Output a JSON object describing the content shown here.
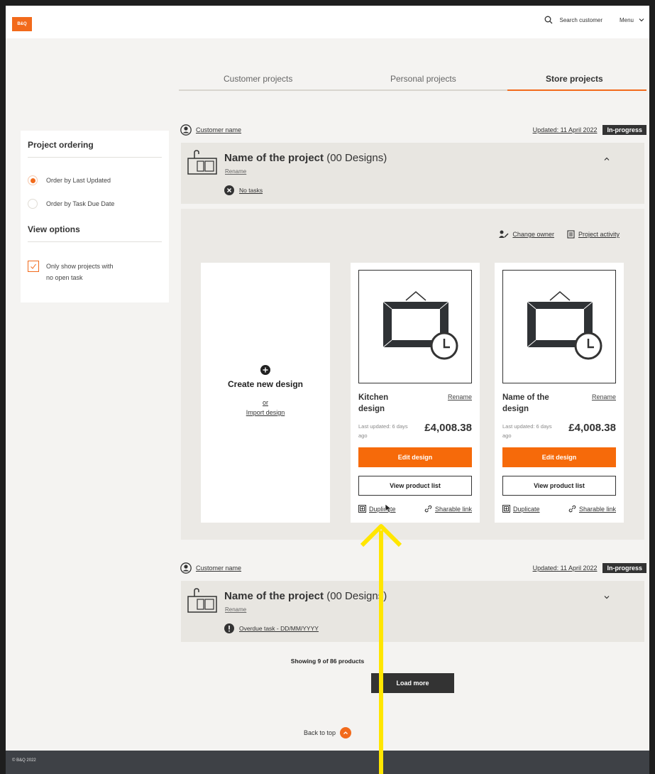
{
  "brand": {
    "logo_text": "B&Q",
    "accent": "#f26a1b"
  },
  "header": {
    "search_label": "Search customer",
    "menu_label": "Menu"
  },
  "tabs": [
    {
      "label": "Customer projects",
      "active": false
    },
    {
      "label": "Personal projects",
      "active": false
    },
    {
      "label": "Store projects",
      "active": true
    }
  ],
  "sidebar": {
    "ordering_heading": "Project ordering",
    "ordering_options": [
      {
        "label": "Order by Last Updated",
        "selected": true
      },
      {
        "label": "Order by Task Due Date",
        "selected": false
      }
    ],
    "view_heading": "View options",
    "view_option_line1": "Only show projects with",
    "view_option_line2": "no open task",
    "view_option_checked": true
  },
  "projects": [
    {
      "customer_name": "Customer name",
      "updated": "Updated: 11 April 2022",
      "status": "In-progress",
      "title": "Name of the project",
      "designs_count": "(00 Designs)",
      "rename": "Rename",
      "task": "No tasks",
      "expanded": true,
      "actions": {
        "change_owner": "Change owner",
        "project_activity": "Project activity"
      },
      "create": {
        "title": "Create new design",
        "or": "or",
        "import": "Import design"
      },
      "designs": [
        {
          "name": "Kitchen design",
          "rename": "Rename",
          "last_updated": "Last updated: 6 days ago",
          "price": "£4,008.38",
          "edit_label": "Edit design",
          "list_label": "View product list",
          "duplicate_label": "Duplicate",
          "share_label": "Sharable link"
        },
        {
          "name": "Name of the design",
          "rename": "Rename",
          "last_updated": "Last updated: 6 days ago",
          "price": "£4,008.38",
          "edit_label": "Edit design",
          "list_label": "View product list",
          "duplicate_label": "Duplicate",
          "share_label": "Sharable link"
        }
      ]
    },
    {
      "customer_name": "Customer name",
      "updated": "Updated: 11 April 2022",
      "status": "In-progress",
      "title": "Name of the project",
      "designs_count": "(00 Designs)",
      "rename": "Rename",
      "task": "Overdue task - DD/MM/YYYY",
      "expanded": false
    }
  ],
  "pagination": {
    "showing": "Showing 9 of 86 products",
    "load_more": "Load more"
  },
  "back_to_top": "Back to top",
  "footer": {
    "copyright": "© B&Q 2022"
  },
  "colors": {
    "accent": "#f26a1b",
    "dark": "#333333",
    "panel": "#e8e6e1",
    "annotation": "#ffe600"
  }
}
